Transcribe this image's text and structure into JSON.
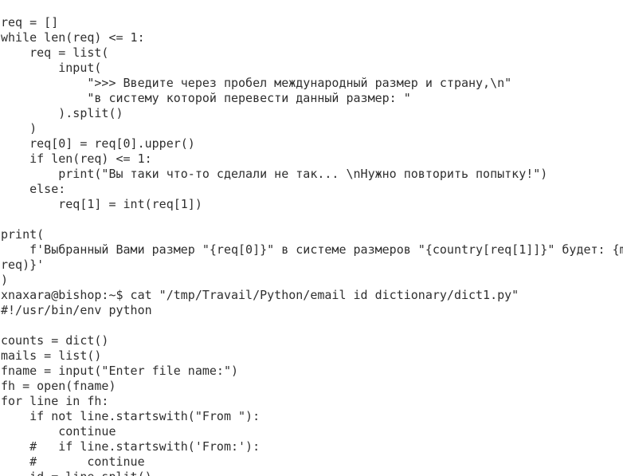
{
  "terminal": {
    "lines": [
      "req = []",
      "while len(req) <= 1:",
      "    req = list(",
      "        input(",
      "            \">>> Введите через пробел международный размер и страну,\\n\"",
      "            \"в систему которой перевести данный размер: \"",
      "        ).split()",
      "    )",
      "    req[0] = req[0].upper()",
      "    if len(req) <= 1:",
      "        print(\"Вы таки что-то сделали не так... \\nНужно повторить попытку!\")",
      "    else:",
      "        req[1] = int(req[1])",
      "",
      "print(",
      "    f'Выбранный Вами размер \"{req[0]}\" в системе размеров \"{country[req[1]]}\" будет: {m",
      "req)}'",
      ")",
      "xnaxara@bishop:~$ cat \"/tmp/Travail/Python/email id dictionary/dict1.py\"",
      "#!/usr/bin/env python",
      "",
      "counts = dict()",
      "mails = list()",
      "fname = input(\"Enter file name:\")",
      "fh = open(fname)",
      "for line in fh:",
      "    if not line.startswith(\"From \"):",
      "        continue",
      "    #   if line.startswith('From:'):",
      "    #       continue",
      "    id = line.split()"
    ]
  }
}
